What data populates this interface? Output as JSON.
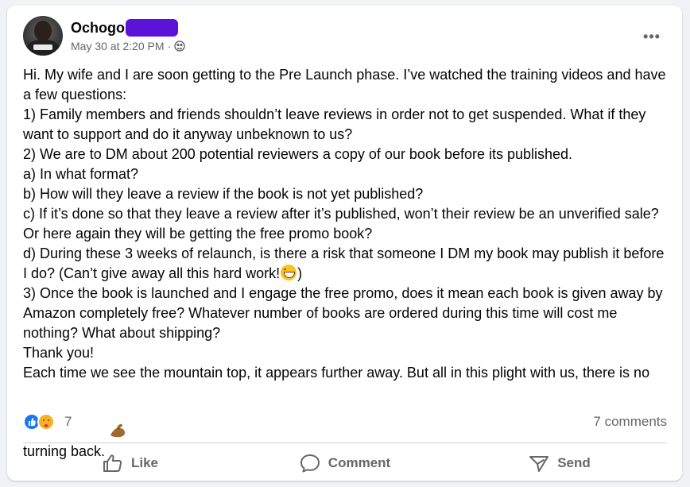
{
  "post": {
    "author": "Ochogo",
    "timestamp": "May 30 at 2:20 PM",
    "privacy_icon": "globe-icon",
    "more_label": "•••",
    "paragraphs": [
      "Hi. My wife and I are soon getting to the Pre Launch phase. I’ve watched the training videos and have a few questions:",
      "1) Family members and friends shouldn’t leave reviews in order not to get suspended. What if they want to support and do it anyway unbeknown to us?",
      "2) We are to DM about 200 potential reviewers a copy of our book before its published.",
      "a) In what format?",
      "b) How will they leave a review if the book is not yet published?",
      "c) If it’s done so that they leave a review after it’s published, won’t their review be an unverified sale? Or here again they will be getting the free promo book?",
      "d) During these 3 weeks of relaunch, is there a risk that someone I DM my book may publish it before I do? (Can’t give away all this hard work!",
      ")",
      "3) Once the book is launched and I engage the free promo, does it mean each book is given away by Amazon completely free? Whatever number of books are ordered during this time will cost me nothing? What about shipping?",
      "Thank you!",
      "Each time we see the mountain top, it appears further away. But all in this plight with us, there is no turning back. "
    ]
  },
  "reactions": {
    "icons": [
      "like-reaction-icon",
      "care-reaction-icon"
    ],
    "count": "7",
    "comments": "7 comments"
  },
  "actions": {
    "like": "Like",
    "comment": "Comment",
    "send": "Send"
  },
  "colors": {
    "accent": "#1877f2",
    "redaction": "#5b12d9",
    "secondary_text": "#65676b"
  }
}
